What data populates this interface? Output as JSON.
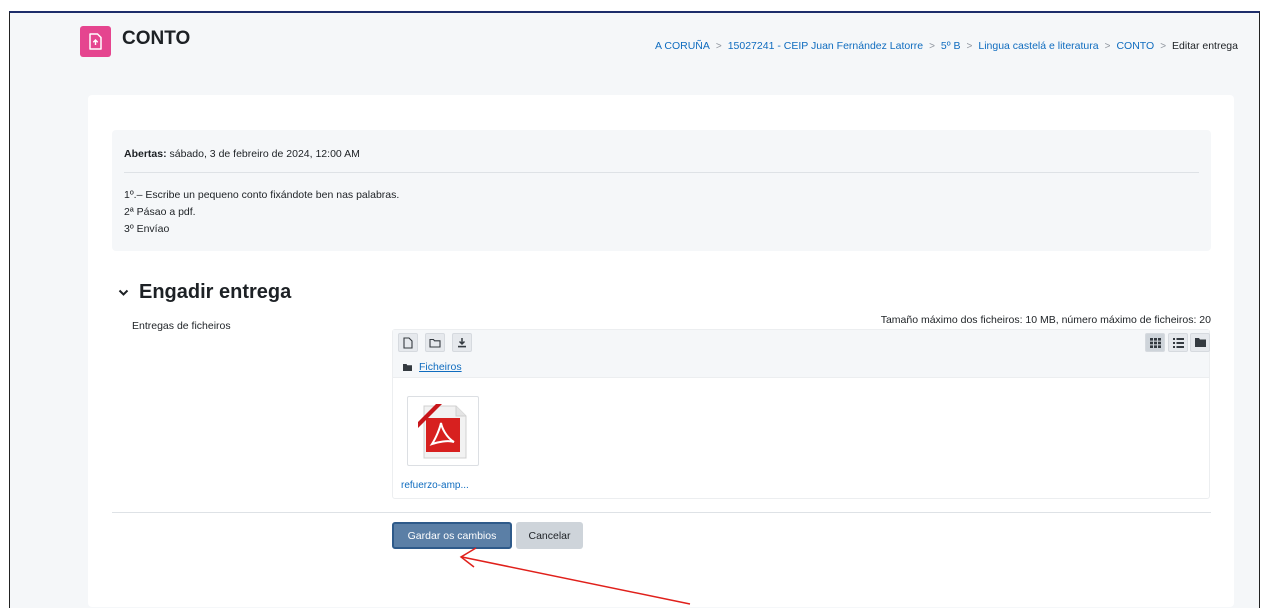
{
  "page": {
    "title": "CONTO"
  },
  "breadcrumb": [
    {
      "label": "A CORUÑA",
      "link": true
    },
    {
      "label": "15027241 - CEIP Juan Fernández Latorre",
      "link": true
    },
    {
      "label": "5º B",
      "link": true
    },
    {
      "label": "Lingua castelá e literatura",
      "link": true
    },
    {
      "label": "CONTO",
      "link": true
    },
    {
      "label": "Editar entrega",
      "link": false
    }
  ],
  "info": {
    "opened_label": "Abertas:",
    "opened_value": " sábado, 3 de febreiro de 2024, 12:00 AM",
    "instructions": [
      "1º.– Escribe un pequeno conto fixándote ben nas palabras.",
      "2ª Pásao a pdf.",
      "3º Envíao"
    ]
  },
  "section": {
    "title": "Engadir entrega"
  },
  "file_submissions": {
    "label": "Entregas de ficheiros",
    "limits": "Tamaño máximo dos ficheiros: 10 MB, número máximo de ficheiros: 20",
    "path_label": "Ficheiros",
    "files": [
      {
        "name": "refuerzo-amp...",
        "icon": "pdf-file-icon"
      }
    ]
  },
  "buttons": {
    "save": "Gardar os cambios",
    "cancel": "Cancelar"
  },
  "colors": {
    "activity_icon": "#e5458f",
    "link": "#0f6cbf",
    "primary_button": "#5b7fa6",
    "annotation_arrow": "#e0201b"
  }
}
